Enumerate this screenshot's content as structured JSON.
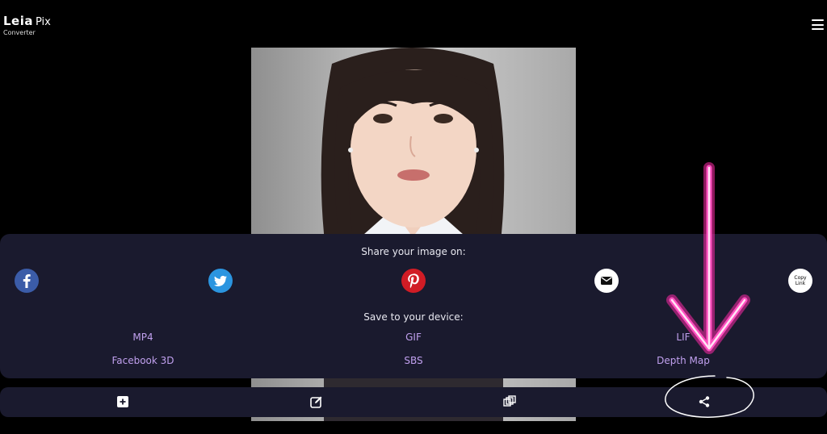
{
  "app": {
    "brand": "Leia",
    "brand_suffix": "Pix",
    "subtitle": "Converter"
  },
  "share": {
    "title": "Share your image on:",
    "targets": [
      {
        "name": "Facebook",
        "icon": "facebook-icon"
      },
      {
        "name": "Twitter",
        "icon": "twitter-icon"
      },
      {
        "name": "Pinterest",
        "icon": "pinterest-icon"
      },
      {
        "name": "Email",
        "icon": "mail-icon"
      },
      {
        "name": "Copy Link",
        "icon": "copy-link-icon",
        "label_line1": "Copy",
        "label_line2": "Link"
      }
    ]
  },
  "save": {
    "title": "Save to your device:",
    "options": [
      "MP4",
      "GIF",
      "LIF",
      "Facebook 3D",
      "SBS",
      "Depth Map"
    ]
  },
  "toolbar": {
    "buttons": [
      {
        "icon": "add-icon"
      },
      {
        "icon": "edit-icon"
      },
      {
        "icon": "layers-icon"
      },
      {
        "icon": "share-icon"
      }
    ]
  },
  "colors": {
    "panel_bg": "#1a1a2e",
    "save_link": "#c0a0ee",
    "annotation": "#ff2aa8"
  }
}
